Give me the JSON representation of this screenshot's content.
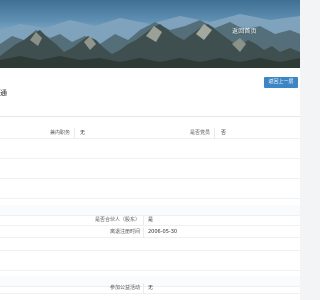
{
  "header": {
    "nav_link": "返回首页"
  },
  "page": {
    "title": "通",
    "back_button": "返回上一层"
  },
  "details": {
    "row1": {
      "label_a": "兼内职务",
      "value_a": "无",
      "label_b": "是否党员",
      "value_b": "否"
    },
    "row2": {
      "label": "是否合伙人（股东）",
      "value": "是"
    },
    "row3": {
      "label": "离退注册时间",
      "value": "2006-05-30"
    },
    "row4": {
      "label": "参加公益活动",
      "value": "无"
    }
  }
}
